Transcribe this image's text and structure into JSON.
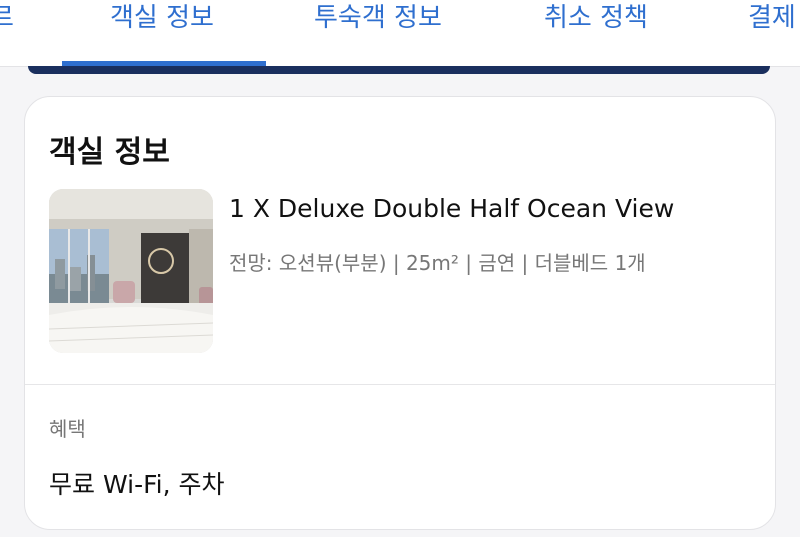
{
  "tabs": [
    {
      "label": "르"
    },
    {
      "label": "객실 정보"
    },
    {
      "label": "투숙객 정보"
    },
    {
      "label": "취소 정책"
    },
    {
      "label": "결제"
    }
  ],
  "active_tab": "객실 정보",
  "card": {
    "title": "객실 정보",
    "room_name": "1 X Deluxe Double Half Ocean View",
    "room_meta": "전망: 오션뷰(부분) | 25m² | 금연 | 더블베드 1개",
    "benefit_label": "혜택",
    "benefit_value": "무료 Wi-Fi, 주차"
  },
  "colors": {
    "accent": "#2f6fcf",
    "banner": "#1a2f5e",
    "text_primary": "#111111",
    "text_secondary": "#777777"
  }
}
